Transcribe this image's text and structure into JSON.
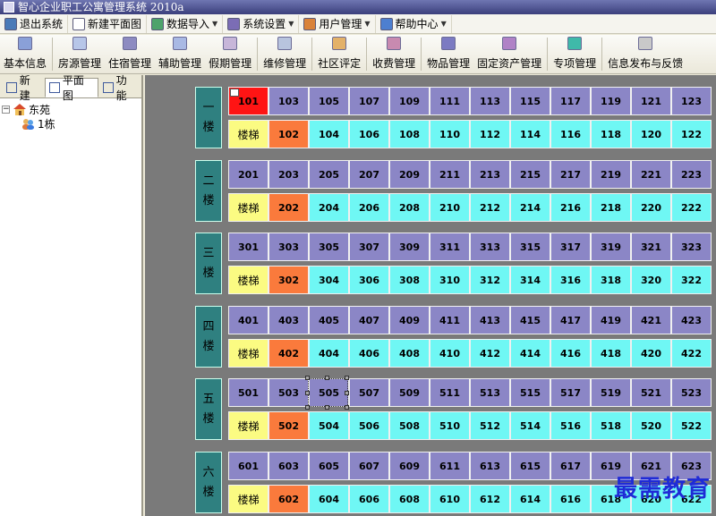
{
  "window": {
    "title": "智心企业职工公寓管理系统 2010a"
  },
  "menubar": [
    {
      "label": "退出系统",
      "icon": "exit-icon",
      "color": "#4a7ab8"
    },
    {
      "label": "新建平面图",
      "icon": "new-document-icon",
      "color": "#ffffff"
    },
    {
      "label": "数据导入",
      "icon": "import-icon",
      "color": "#4da36b",
      "dropdown": true
    },
    {
      "label": "系统设置",
      "icon": "settings-icon",
      "color": "#7b6db5",
      "dropdown": true
    },
    {
      "label": "用户管理",
      "icon": "users-icon",
      "color": "#d9823a",
      "dropdown": true
    },
    {
      "label": "帮助中心",
      "icon": "help-icon",
      "color": "#4d7fd0",
      "dropdown": true
    }
  ],
  "toolbar": [
    {
      "label": "基本信息",
      "icon": "calendar-icon",
      "color": "#8aa0d8"
    },
    {
      "label": "房源管理",
      "icon": "house-list-icon",
      "color": "#b7c6e8"
    },
    {
      "label": "住宿管理",
      "icon": "bed-icon",
      "color": "#8d8bc1"
    },
    {
      "label": "辅助管理",
      "icon": "tools-icon",
      "color": "#a9b9e4"
    },
    {
      "label": "假期管理",
      "icon": "holiday-icon",
      "color": "#c7b6d9"
    },
    {
      "label": "维修管理",
      "icon": "repair-icon",
      "color": "#b8c4de"
    },
    {
      "label": "社区评定",
      "icon": "community-icon",
      "color": "#e3b169"
    },
    {
      "label": "收费管理",
      "icon": "fee-icon",
      "color": "#c88ab0"
    },
    {
      "label": "物品管理",
      "icon": "items-icon",
      "color": "#7c7bc2"
    },
    {
      "label": "固定资产管理",
      "icon": "assets-icon",
      "color": "#b082c6"
    },
    {
      "label": "专项管理",
      "icon": "special-icon",
      "color": "#3fb9a9"
    },
    {
      "label": "信息发布与反馈",
      "icon": "message-icon",
      "color": "#c9c9c9"
    }
  ],
  "left_tabs": [
    {
      "label": "新建",
      "active": false
    },
    {
      "label": "平面图",
      "active": true
    },
    {
      "label": "功能",
      "active": false
    }
  ],
  "tree": {
    "root": "东苑",
    "child": "1栋"
  },
  "floors": [
    {
      "label_top": "一",
      "label_bottom": "楼",
      "upper": [
        "101",
        "103",
        "105",
        "107",
        "109",
        "111",
        "113",
        "115",
        "117",
        "119",
        "121",
        "123"
      ],
      "lower": [
        "楼梯",
        "102",
        "104",
        "106",
        "108",
        "110",
        "112",
        "114",
        "116",
        "118",
        "120",
        "122"
      ]
    },
    {
      "label_top": "二",
      "label_bottom": "楼",
      "upper": [
        "201",
        "203",
        "205",
        "207",
        "209",
        "211",
        "213",
        "215",
        "217",
        "219",
        "221",
        "223"
      ],
      "lower": [
        "楼梯",
        "202",
        "204",
        "206",
        "208",
        "210",
        "212",
        "214",
        "216",
        "218",
        "220",
        "222"
      ]
    },
    {
      "label_top": "三",
      "label_bottom": "楼",
      "upper": [
        "301",
        "303",
        "305",
        "307",
        "309",
        "311",
        "313",
        "315",
        "317",
        "319",
        "321",
        "323"
      ],
      "lower": [
        "楼梯",
        "302",
        "304",
        "306",
        "308",
        "310",
        "312",
        "314",
        "316",
        "318",
        "320",
        "322"
      ]
    },
    {
      "label_top": "四",
      "label_bottom": "楼",
      "upper": [
        "401",
        "403",
        "405",
        "407",
        "409",
        "411",
        "413",
        "415",
        "417",
        "419",
        "421",
        "423"
      ],
      "lower": [
        "楼梯",
        "402",
        "404",
        "406",
        "408",
        "410",
        "412",
        "414",
        "416",
        "418",
        "420",
        "422"
      ]
    },
    {
      "label_top": "五",
      "label_bottom": "楼",
      "upper": [
        "501",
        "503",
        "505",
        "507",
        "509",
        "511",
        "513",
        "515",
        "517",
        "519",
        "521",
        "523"
      ],
      "lower": [
        "楼梯",
        "502",
        "504",
        "506",
        "508",
        "510",
        "512",
        "514",
        "516",
        "518",
        "520",
        "522"
      ]
    },
    {
      "label_top": "六",
      "label_bottom": "楼",
      "upper": [
        "601",
        "603",
        "605",
        "607",
        "609",
        "611",
        "613",
        "615",
        "617",
        "619",
        "621",
        "623"
      ],
      "lower": [
        "楼梯",
        "602",
        "604",
        "606",
        "608",
        "610",
        "612",
        "614",
        "616",
        "618",
        "620",
        "622"
      ]
    }
  ],
  "occupied_room": "101",
  "selected_room": "505",
  "colors": {
    "odd_room": "#8b86c6",
    "even_room": "#6ff7f4",
    "stair": "#fbfb82",
    "corner_room": "#fa7a3c",
    "occupied": "#ff1414",
    "floor_label": "#2f8080"
  },
  "watermark": "最需教育"
}
